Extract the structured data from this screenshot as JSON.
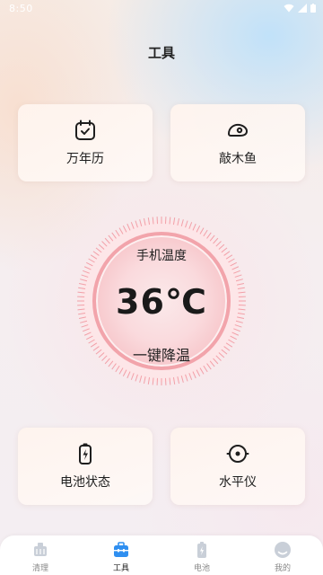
{
  "status_bar": {
    "time": "8:50"
  },
  "header": {
    "title": "工具"
  },
  "cards": {
    "calendar": {
      "label": "万年历",
      "icon": "calendar-check-icon"
    },
    "fish": {
      "label": "敲木鱼",
      "icon": "wooden-fish-icon"
    },
    "battery": {
      "label": "电池状态",
      "icon": "battery-charging-icon"
    },
    "level": {
      "label": "水平仪",
      "icon": "level-target-icon"
    }
  },
  "thermometer": {
    "label": "手机温度",
    "value": "36℃",
    "action": "一键降温"
  },
  "tabbar": {
    "items": [
      {
        "label": "清理",
        "icon": "broom-clean-icon",
        "active": false
      },
      {
        "label": "工具",
        "icon": "toolbox-icon",
        "active": true
      },
      {
        "label": "电池",
        "icon": "battery-icon",
        "active": false
      },
      {
        "label": "我的",
        "icon": "profile-icon",
        "active": false
      }
    ]
  },
  "colors": {
    "accent_blue": "#2f8ff0",
    "ring_pink": "#f2a4ab",
    "inactive_gray": "#c9cfd8"
  }
}
